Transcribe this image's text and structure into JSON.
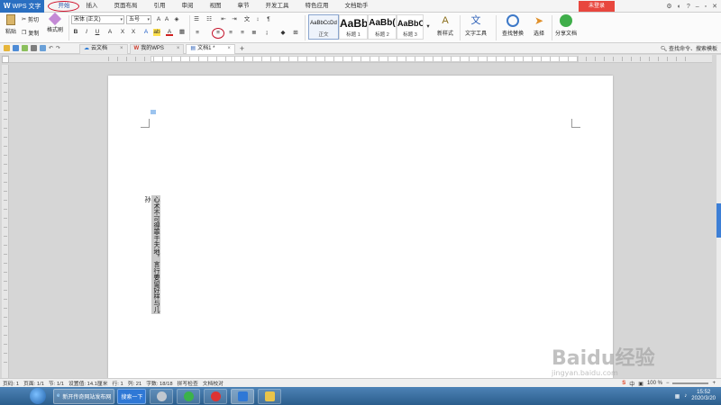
{
  "app": {
    "title": "WPS 文字",
    "logo": "W"
  },
  "menu": {
    "tabs": [
      "开始",
      "插入",
      "页面布局",
      "引用",
      "审阅",
      "视图",
      "章节",
      "开发工具",
      "特色应用",
      "文档助手"
    ],
    "active_tab": "开始",
    "login_label": "未登录"
  },
  "ribbon": {
    "paste_label": "粘贴",
    "cut_label": "剪切",
    "copy_label": "复制",
    "format_painter_label": "格式刷",
    "font_name": "宋体 (正文)",
    "font_size": "五号",
    "styles": [
      {
        "sample": "AaBbCcDd",
        "label": "正文"
      },
      {
        "sample": "AaBb",
        "label": "标题 1"
      },
      {
        "sample": "AaBb(",
        "label": "标题 2"
      },
      {
        "sample": "AaBbC",
        "label": "标题 3"
      }
    ],
    "new_style_label": "新样式",
    "text_tools_label": "文字工具",
    "find_replace_label": "查找替换",
    "select_label": "选择",
    "share_label": "分享文档"
  },
  "tabs": {
    "items": [
      {
        "label": "云文档",
        "active": false
      },
      {
        "label": "我的WPS",
        "active": false
      },
      {
        "label": "文档1 *",
        "active": true
      }
    ],
    "add": "+",
    "search_cmd": "查找命令、搜索模板"
  },
  "document": {
    "vertical_text": "心术不可得罪于天地，言行要留好样与儿孙"
  },
  "status": {
    "page_num": "页码: 1",
    "pages": "页面: 1/1",
    "section": "节: 1/1",
    "setting": "设置值: 14.1厘米",
    "row": "行: 1",
    "col": "列: 21",
    "word_count": "字数: 18/18",
    "spell": "拼写检查",
    "proofread": "文档校对",
    "zoom": "100 %"
  },
  "taskbar": {
    "ie_label": "新开传奇网站发布网",
    "search_label": "搜索一下",
    "time": "15:52",
    "date": "2020/3/20"
  },
  "watermark": {
    "text": "Baidu经验",
    "sub": "jingyan.baidu.com"
  }
}
